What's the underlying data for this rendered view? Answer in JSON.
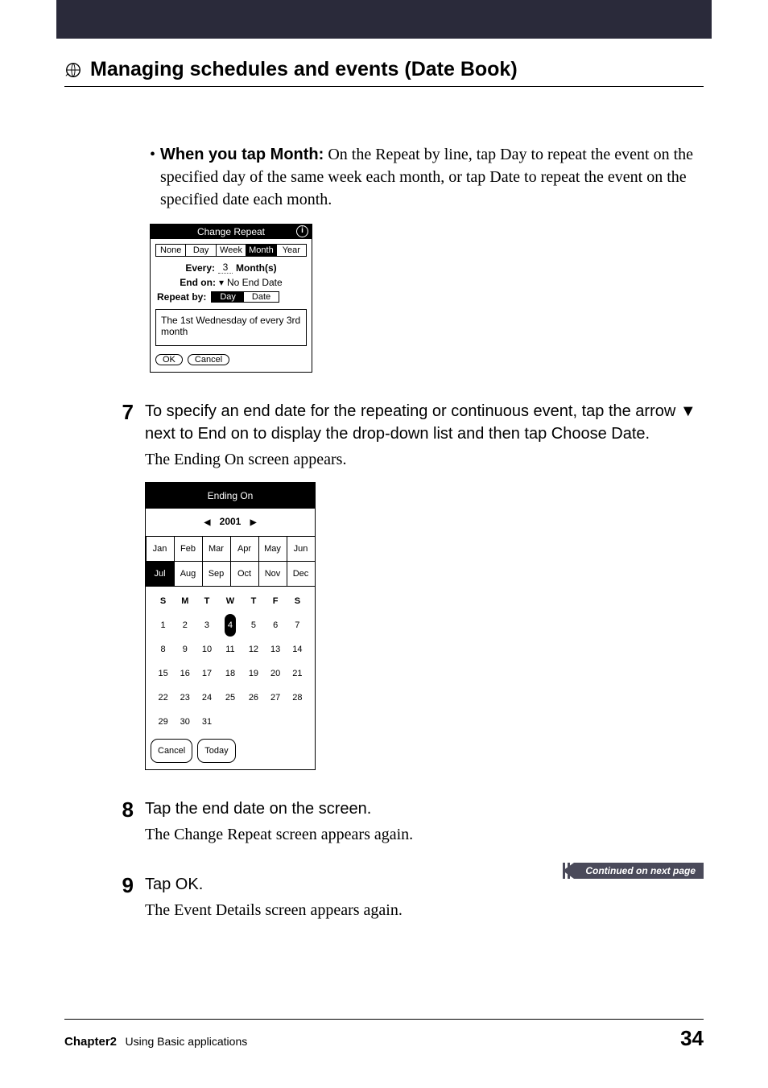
{
  "section_title": "Managing schedules and events (Date Book)",
  "bullet": {
    "lead": "When you tap Month:",
    "rest": " On the Repeat by line, tap Day to repeat the event on the specified day of the same week each month, or tap Date to repeat the event on the specified date each month."
  },
  "change_repeat": {
    "title": "Change Repeat",
    "tabs": [
      "None",
      "Day",
      "Week",
      "Month",
      "Year"
    ],
    "tab_selected": "Month",
    "every_label": "Every:",
    "every_value": "3",
    "every_unit": "Month(s)",
    "endon_label": "End on:",
    "endon_value": "No End Date",
    "repeatby_label": "Repeat by:",
    "repeatby_options": [
      "Day",
      "Date"
    ],
    "repeatby_selected": "Day",
    "description": "The 1st Wednesday of every 3rd month",
    "ok": "OK",
    "cancel": "Cancel"
  },
  "steps": {
    "s7": {
      "num": "7",
      "text": "To specify an end date for the repeating or continuous event, tap the arrow ▼ next to End on to display the drop-down list and then tap Choose Date.",
      "after": "The Ending On screen appears."
    },
    "s8": {
      "num": "8",
      "text": "Tap the end date on the screen.",
      "after": "The Change Repeat screen appears again."
    },
    "s9": {
      "num": "9",
      "text": "Tap OK.",
      "after": "The Event Details screen appears again."
    }
  },
  "ending_on": {
    "title": "Ending On",
    "year": "2001",
    "months": [
      "Jan",
      "Feb",
      "Mar",
      "Apr",
      "May",
      "Jun",
      "Jul",
      "Aug",
      "Sep",
      "Oct",
      "Nov",
      "Dec"
    ],
    "month_selected": "Jul",
    "dows": [
      "S",
      "M",
      "T",
      "W",
      "T",
      "F",
      "S"
    ],
    "rows": [
      [
        "1",
        "2",
        "3",
        "4",
        "5",
        "6",
        "7"
      ],
      [
        "8",
        "9",
        "10",
        "11",
        "12",
        "13",
        "14"
      ],
      [
        "15",
        "16",
        "17",
        "18",
        "19",
        "20",
        "21"
      ],
      [
        "22",
        "23",
        "24",
        "25",
        "26",
        "27",
        "28"
      ],
      [
        "29",
        "30",
        "31",
        "",
        "",
        "",
        ""
      ]
    ],
    "selected_day": "4",
    "cancel": "Cancel",
    "today": "Today"
  },
  "continued": "Continued on next page",
  "footer": {
    "chapter": "Chapter2",
    "subtitle": "Using Basic applications",
    "page": "34"
  }
}
